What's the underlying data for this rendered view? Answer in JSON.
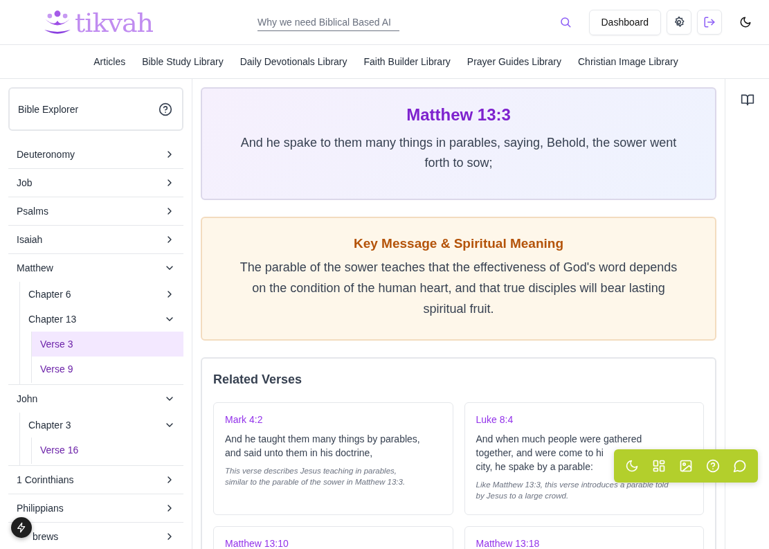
{
  "header": {
    "logo": "tikvah",
    "search": {
      "placeholder": "Why we need Biblical Based AI"
    },
    "buttons": [
      {
        "kind": "text",
        "label": "Dashboard"
      },
      {
        "kind": "settings"
      },
      {
        "kind": "logout"
      },
      {
        "kind": "theme"
      }
    ]
  },
  "nav": [
    "Articles",
    "Bible Study Library",
    "Daily Devotionals Library",
    "Faith Builder Library",
    "Prayer Guides Library",
    "Christian Image Library"
  ],
  "sidebar": {
    "title": "Bible Explorer",
    "items": [
      {
        "label": "Deuteronomy",
        "expanded": false,
        "selected": false
      },
      {
        "label": "Job",
        "expanded": false,
        "selected": false
      },
      {
        "label": "Psalms",
        "expanded": false,
        "selected": false
      },
      {
        "label": "Isaiah",
        "expanded": false,
        "selected": false
      },
      {
        "label": "Matthew",
        "expanded": true,
        "selected": false,
        "children": [
          {
            "label": "Chapter 6",
            "expanded": false,
            "selected": false
          },
          {
            "label": "Chapter 13",
            "expanded": true,
            "selected": false,
            "children": [
              {
                "label": "Verse 3",
                "selected": true
              },
              {
                "label": "Verse 9",
                "selected": false
              }
            ]
          }
        ]
      },
      {
        "label": "John",
        "expanded": true,
        "selected": false,
        "children": [
          {
            "label": "Chapter 3",
            "expanded": true,
            "selected": false,
            "children": [
              {
                "label": "Verse 16",
                "selected": false
              }
            ]
          }
        ]
      },
      {
        "label": "1 Corinthians",
        "expanded": false,
        "selected": false
      },
      {
        "label": "Philippians",
        "expanded": false,
        "selected": false
      },
      {
        "label": "brews",
        "expanded": false,
        "selected": false
      }
    ]
  },
  "verse": {
    "reference": "Matthew 13:3",
    "text": "And he spake to them many things in parables, saying, Behold, the sower went forth to sow;"
  },
  "key_message": {
    "title": "Key Message & Spiritual Meaning",
    "text": "The parable of the sower teaches that the effectiveness of God's word depends on the condition of the human heart, and that true disciples will bear lasting spiritual fruit."
  },
  "related": {
    "title": "Related Verses",
    "verses": [
      {
        "reference": "Mark 4:2",
        "text": "And he taught them many things by parables, and said unto them in his doctrine,",
        "note": "This verse describes Jesus teaching in parables, similar to the parable of the sower in Matthew 13:3."
      },
      {
        "reference": "Luke 8:4",
        "text": "And when much people were gathered together, and were come to hi",
        "text_2": "city, he spake by a parable:",
        "note": "Like Matthew 13:3, this verse introduces a parable told by Jesus to a large crowd."
      },
      {
        "reference": "Matthew 13:10"
      },
      {
        "reference": "Matthew 13:18"
      }
    ]
  },
  "floating_toolbar": [
    {
      "kind": "theme"
    },
    {
      "kind": "grid"
    },
    {
      "kind": "image"
    },
    {
      "kind": "help"
    },
    {
      "kind": "chat"
    }
  ]
}
